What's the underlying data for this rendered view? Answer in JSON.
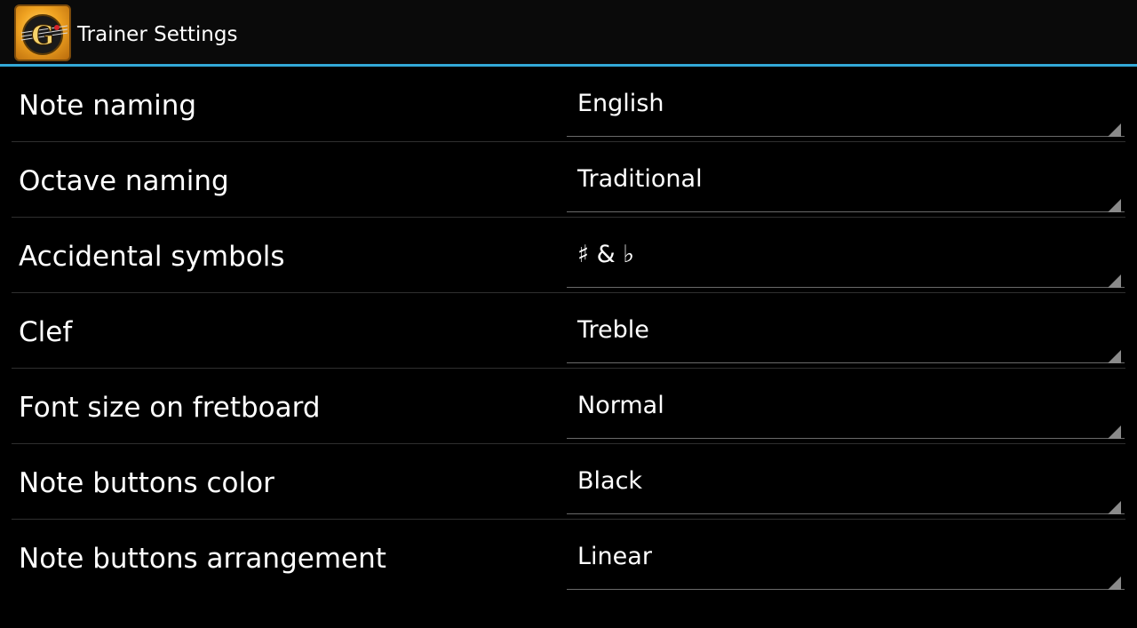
{
  "action_bar": {
    "title": "Trainer Settings",
    "icon": "guitar-g-app-icon",
    "icon_letter": "G",
    "accent_color": "#33a9d8"
  },
  "settings": [
    {
      "label": "Note naming",
      "value": "English"
    },
    {
      "label": "Octave naming",
      "value": "Traditional"
    },
    {
      "label": "Accidental symbols",
      "value": "♯ & ♭"
    },
    {
      "label": "Clef",
      "value": "Treble"
    },
    {
      "label": "Font size on fretboard",
      "value": "Normal"
    },
    {
      "label": "Note buttons color",
      "value": "Black"
    },
    {
      "label": "Note buttons arrangement",
      "value": "Linear"
    }
  ]
}
